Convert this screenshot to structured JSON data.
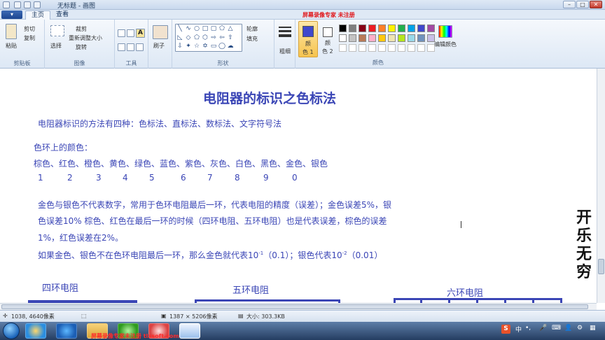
{
  "window": {
    "title": "无标题 - 画图",
    "watermark": "屏幕录像专家  未注册",
    "minimize": "–",
    "maximize": "□",
    "close": "✕"
  },
  "tabs": {
    "menu": "▾",
    "home": "主页",
    "view": "查看"
  },
  "ribbon": {
    "clipboard": {
      "paste": "粘贴",
      "cut": "剪切",
      "copy": "复制",
      "label": "剪贴板"
    },
    "image": {
      "select": "选择",
      "crop": "裁剪",
      "resize": "重新调整大小",
      "rotate": "旋转",
      "label": "图像"
    },
    "tools": {
      "label": "工具"
    },
    "brushes": {
      "label": "刷子"
    },
    "shapes": {
      "outline": "轮廓",
      "fill": "填充",
      "label": "形状"
    },
    "size": {
      "label": "粗细"
    },
    "color1": {
      "label1": "颜",
      "label2": "色 1"
    },
    "color2": {
      "label1": "颜",
      "label2": "色 2"
    },
    "colors": {
      "label": "颜色",
      "edit": "编辑颜色"
    },
    "palette_row1": [
      "#000000",
      "#7f7f7f",
      "#880015",
      "#ed1c24",
      "#ff7f27",
      "#fff200",
      "#22b14c",
      "#00a2e8",
      "#3f48cc",
      "#a349a4"
    ],
    "palette_row2": [
      "#ffffff",
      "#c3c3c3",
      "#b97a57",
      "#ffaec9",
      "#ffc90e",
      "#efe4b0",
      "#b5e61d",
      "#99d9ea",
      "#7092be",
      "#c8bfe7"
    ],
    "color1_value": "#3f48cc",
    "color2_value": "#ffffff"
  },
  "document": {
    "title": "电阻器的标识之色标法",
    "intro": "电阻器标识的方法有四种：色标法、直标法、数标法、文字符号法",
    "colors_heading": "色环上的颜色：",
    "colors_line": "棕色、红色、橙色、黄色、绿色、蓝色、紫色、灰色、白色、黑色、金色、银色",
    "numbers": [
      "1",
      "2",
      "3",
      "4",
      "5",
      "6",
      "7",
      "8",
      "9",
      "0"
    ],
    "para1_line1": "金色与银色不代表数字，常用于色环电阻最后一环，代表电阻的精度（误差）；金色误差5%，银",
    "para1_line2": "色误差10%     棕色、红色在最后一环的时候（四环电阻、五环电阻）也是代表误差，棕色的误差",
    "para1_line3": "1%，红色误差在2%。",
    "para2_pre": "如果金色、银色不在色环电阻最后一环，那么金色就代表10",
    "para2_sup1": "-1",
    "para2_mid": "（0.1）；银色代表10",
    "para2_sup2": "-2",
    "para2_post": "（0.01）",
    "four_ring": "四环电阻",
    "five_ring": "五环电阻",
    "six_ring": "六环电阻"
  },
  "side_text": [
    "开",
    "乐",
    "无",
    "穷"
  ],
  "status": {
    "cursor_pos": "1038, 4640像素",
    "image_size": "1387 × 5206像素",
    "file_size": "大小: 303.3KB"
  },
  "taskbar": {
    "watermark": "屏幕录像专家未注册 tlxsoft.com",
    "ime": "中",
    "tray_extra": "•,"
  }
}
